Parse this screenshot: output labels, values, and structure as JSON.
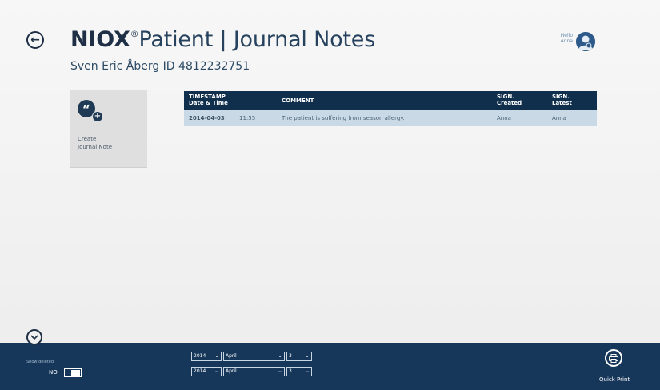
{
  "header": {
    "brand": "NIOX",
    "brand_sup": "®",
    "title_rest": "Patient | Journal Notes",
    "patient_line": "Sven Eric Åberg ID 4812232751"
  },
  "user": {
    "greeting": "Hello",
    "name": "Anna"
  },
  "tile": {
    "label": "Create\nJournal Note"
  },
  "table": {
    "columns": [
      {
        "label": "TIMESTAMP\nDate & Time"
      },
      {
        "label": "COMMENT"
      },
      {
        "label": "SIGN.\nCreated"
      },
      {
        "label": "SIGN.\nLatest"
      }
    ],
    "rows": [
      {
        "date": "2014-04-03",
        "time": "11:55",
        "comment": "The patient is suffering from season allergy.",
        "sign_created": "Anna",
        "sign_latest": "Anna"
      }
    ]
  },
  "bottom": {
    "show_deleted_label": "Show deleted",
    "toggle_value": "NO",
    "from": {
      "year": "2014",
      "month": "April",
      "day": "3"
    },
    "to": {
      "year": "2014",
      "month": "April",
      "day": "3"
    },
    "quick_print_label": "Quick Print"
  },
  "colors": {
    "navy": "#17375a",
    "header_row": "#0f2f4d",
    "data_row": "#c9dae6"
  }
}
